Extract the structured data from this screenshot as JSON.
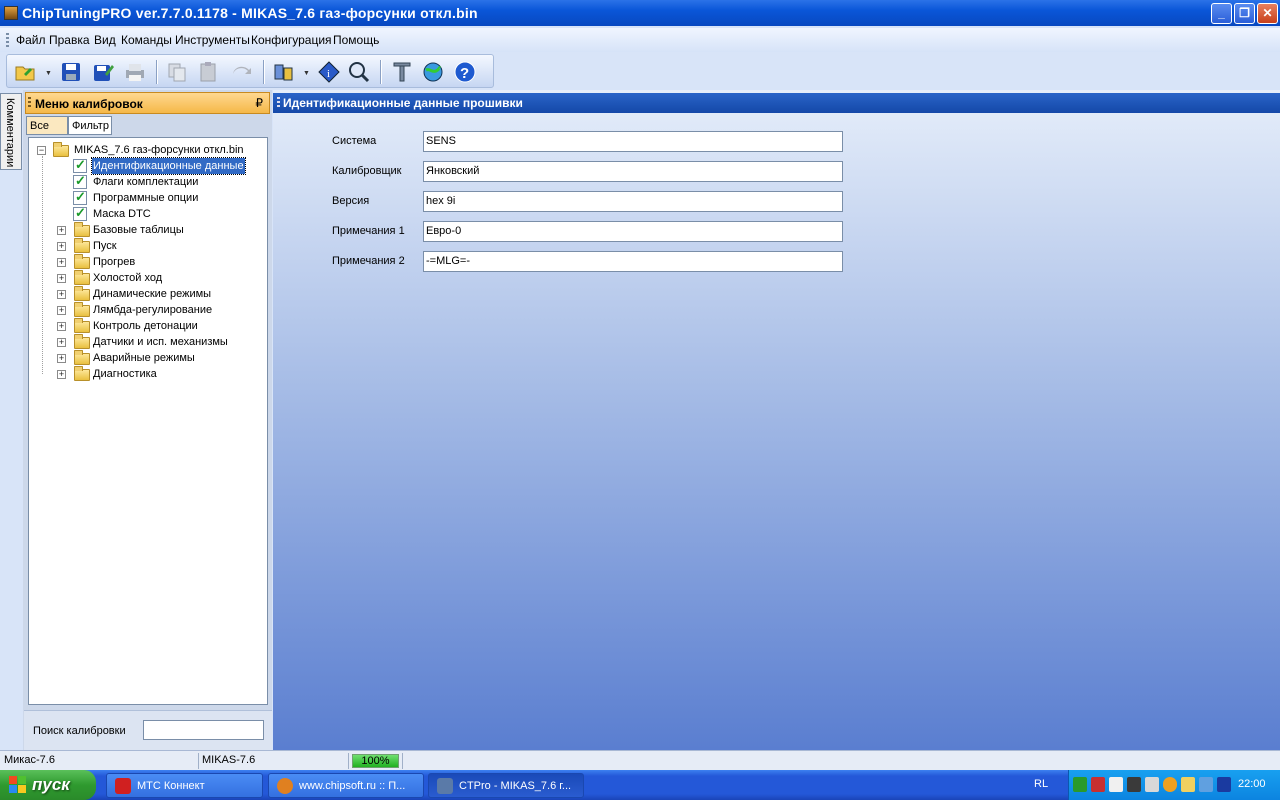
{
  "window": {
    "title": "ChipTuningPRO ver.7.7.0.1178 - MIKAS_7.6 газ-форсунки откл.bin",
    "btn_min": "_",
    "btn_max": "❐",
    "btn_close": "✕"
  },
  "menu": [
    "Файл",
    "Правка",
    "Вид",
    "Команды",
    "Инструменты",
    "Конфигурация",
    "Помощь"
  ],
  "side_tab": "Комментарии",
  "left_panel": {
    "title": "Меню калибровок",
    "pin": "₽",
    "tabs": [
      "Все",
      "Фильтр"
    ],
    "root": "MIKAS_7.6 газ-форсунки откл.bin",
    "checked_items": [
      "Идентификационные данные",
      "Флаги комплектации",
      "Программные опции",
      "Маска DTC"
    ],
    "folders": [
      "Базовые таблицы",
      "Пуск",
      "Прогрев",
      "Холостой ход",
      "Динамические режимы",
      "Лямбда-регулирование",
      "Контроль детонации",
      "Датчики и исп. механизмы",
      "Аварийные режимы",
      "Диагностика"
    ],
    "search_label": "Поиск калибровки",
    "search_value": ""
  },
  "main": {
    "title": "Идентификационные данные прошивки",
    "fields": [
      {
        "label": "Система",
        "value": "SENS"
      },
      {
        "label": "Калибровщик",
        "value": "Янковский"
      },
      {
        "label": "Версия",
        "value": "hex 9i"
      },
      {
        "label": "Примечания 1",
        "value": "Евро-0"
      },
      {
        "label": "Примечания 2",
        "value": "-=MLG=-"
      }
    ]
  },
  "status": {
    "left": "Микас-7.6",
    "middle": "MIKAS-7.6",
    "progress": "100%",
    "progress_fraction": 1.0
  },
  "taskbar": {
    "start": "пуск",
    "tasks": [
      {
        "label": "МТС Коннект",
        "active": false,
        "color": "#d02020"
      },
      {
        "label": "www.chipsoft.ru :: П...",
        "active": false,
        "color": "#e08020"
      },
      {
        "label": "CTPro - MIKAS_7.6 г...",
        "active": true,
        "color": "#5a7aa8"
      }
    ],
    "lang": "RL",
    "clock": "22:00"
  }
}
